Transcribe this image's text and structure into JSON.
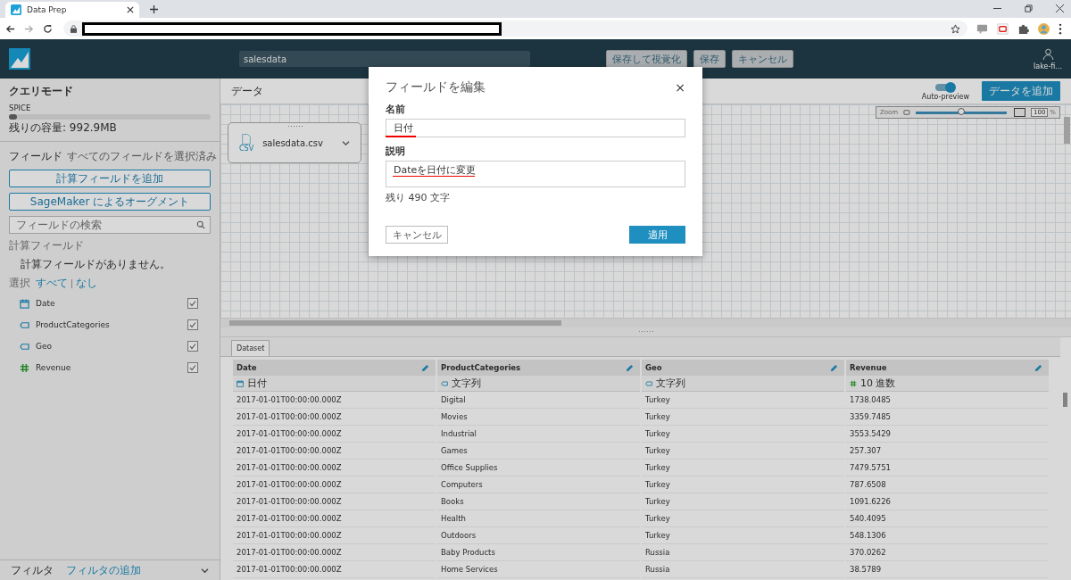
{
  "browser": {
    "tab_title": "Data Prep"
  },
  "header": {
    "dataset_name": "salesdata",
    "buttons": [
      "保存して視覚化",
      "保存",
      "キャンセル"
    ],
    "user": "lake-fi..."
  },
  "sidebar": {
    "query_mode_title": "クエリモード",
    "spice_label": "SPICE",
    "spice_level": {
      "level": 0.02
    },
    "capacity": "残りの容量: 992.9MB",
    "fields_title": "フィールド",
    "fields_status": "すべてのフィールドを選択済み",
    "add_calc_button": "計算フィールドを追加",
    "sagemaker_button": "SageMaker によるオーグメント",
    "search_placeholder": "フィールドの検索",
    "calc_title": "計算フィールド",
    "calc_empty": "計算フィールドがありません。",
    "select_label": "選択",
    "select_all": "すべて",
    "select_none": "なし",
    "fields": [
      {
        "name": "Date",
        "kind": "date",
        "checked": true
      },
      {
        "name": "ProductCategories",
        "kind": "string",
        "checked": true
      },
      {
        "name": "Geo",
        "kind": "string",
        "checked": true
      },
      {
        "name": "Revenue",
        "kind": "number",
        "checked": true
      }
    ],
    "filter_title": "フィルタ",
    "filter_add": "フィルタの追加"
  },
  "main": {
    "title": "データ",
    "auto_preview": {
      "label": "Auto-preview",
      "on": true
    },
    "add_data_button": "データを追加",
    "zoom": {
      "label": "Zoom",
      "level": 0.5,
      "value": "100",
      "unit": "%"
    },
    "source_card": {
      "name": "salesdata.csv",
      "file_type": "CSV"
    }
  },
  "table": {
    "tab": "Dataset",
    "columns": [
      {
        "name": "Date",
        "kind": "date",
        "type_label": "日付"
      },
      {
        "name": "ProductCategories",
        "kind": "string",
        "type_label": "文字列"
      },
      {
        "name": "Geo",
        "kind": "string",
        "type_label": "文字列"
      },
      {
        "name": "Revenue",
        "kind": "number",
        "type_label": "10 進数"
      }
    ],
    "rows": [
      [
        "2017-01-01T00:00:00.000Z",
        "Digital",
        "Turkey",
        "1738.0485"
      ],
      [
        "2017-01-01T00:00:00.000Z",
        "Movies",
        "Turkey",
        "3359.7485"
      ],
      [
        "2017-01-01T00:00:00.000Z",
        "Industrial",
        "Turkey",
        "3553.5429"
      ],
      [
        "2017-01-01T00:00:00.000Z",
        "Games",
        "Turkey",
        "257.307"
      ],
      [
        "2017-01-01T00:00:00.000Z",
        "Office Supplies",
        "Turkey",
        "7479.5751"
      ],
      [
        "2017-01-01T00:00:00.000Z",
        "Computers",
        "Turkey",
        "787.6508"
      ],
      [
        "2017-01-01T00:00:00.000Z",
        "Books",
        "Turkey",
        "1091.6226"
      ],
      [
        "2017-01-01T00:00:00.000Z",
        "Health",
        "Turkey",
        "540.4095"
      ],
      [
        "2017-01-01T00:00:00.000Z",
        "Outdoors",
        "Turkey",
        "548.1306"
      ],
      [
        "2017-01-01T00:00:00.000Z",
        "Baby Products",
        "Russia",
        "370.0262"
      ],
      [
        "2017-01-01T00:00:00.000Z",
        "Home Services",
        "Russia",
        "38.5789"
      ]
    ]
  },
  "dialog": {
    "title": "フィールドを編集",
    "close": "×",
    "name_label": "名前",
    "name_value": "日付",
    "description_label": "説明",
    "description_value": "Dateを日付に変更",
    "remaining": "残り 490 文字",
    "cancel_button": "キャンセル",
    "apply_button": "適用"
  }
}
